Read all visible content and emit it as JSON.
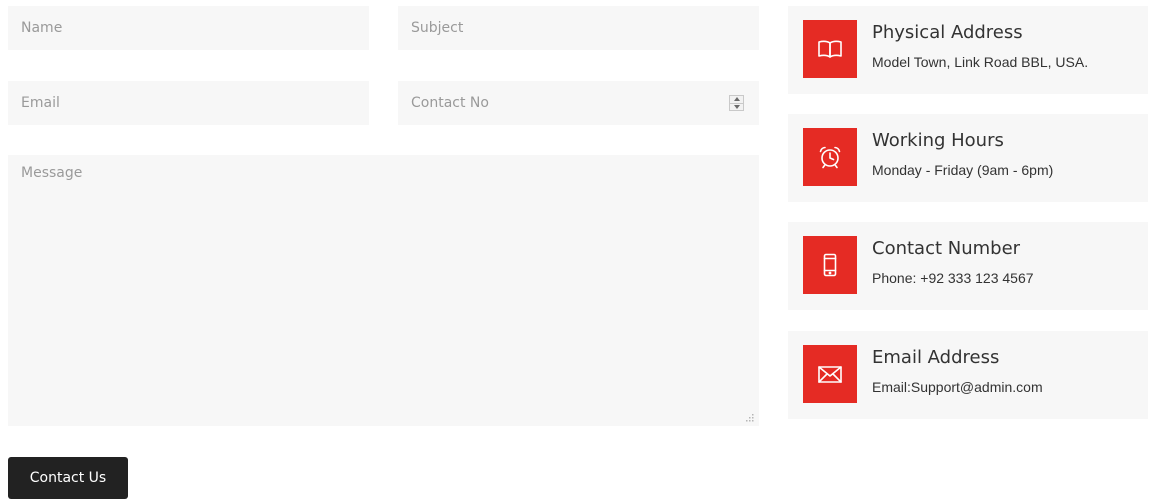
{
  "form": {
    "name": {
      "placeholder": "Name",
      "value": ""
    },
    "subject": {
      "placeholder": "Subject",
      "value": ""
    },
    "email": {
      "placeholder": "Email",
      "value": ""
    },
    "contact": {
      "placeholder": "Contact No",
      "value": ""
    },
    "message": {
      "placeholder": "Message",
      "value": ""
    },
    "submit_label": "Contact Us"
  },
  "info_cards": [
    {
      "icon": "book-icon",
      "title": "Physical Address",
      "text": "Model Town, Link Road BBL, USA."
    },
    {
      "icon": "alarm-clock-icon",
      "title": "Working Hours",
      "text": "Monday - Friday (9am - 6pm)"
    },
    {
      "icon": "smartphone-icon",
      "title": "Contact Number",
      "text": "Phone: +92 333 123 4567"
    },
    {
      "icon": "envelope-icon",
      "title": "Email Address",
      "text": "Email:Support@admin.com"
    }
  ],
  "colors": {
    "accent": "#e52b24",
    "field_background": "#f7f7f7",
    "button_background": "#222222",
    "text": "#333333",
    "placeholder": "#9a9a9a"
  }
}
